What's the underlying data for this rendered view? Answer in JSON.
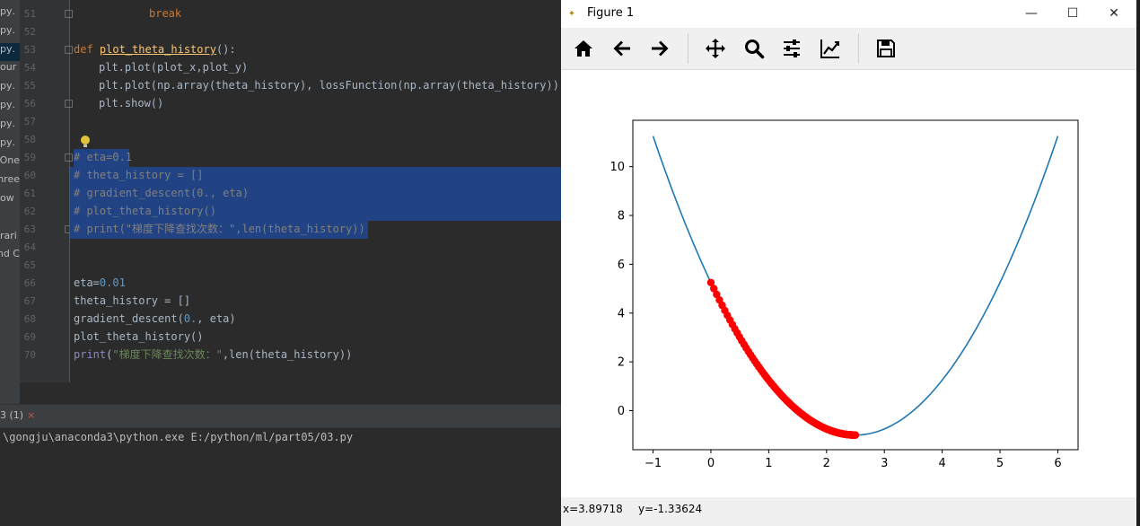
{
  "project_items": [
    {
      "label": ".py",
      "selected": false
    },
    {
      "label": ".py",
      "selected": false
    },
    {
      "label": ".py",
      "selected": true
    },
    {
      "label": "our",
      "selected": false
    },
    {
      "label": ".py",
      "selected": false
    },
    {
      "label": ".py",
      "selected": false
    },
    {
      "label": ".py",
      "selected": false
    },
    {
      "label": ".py",
      "selected": false
    },
    {
      "label": "One",
      "selected": false
    },
    {
      "label": "hree",
      "selected": false
    },
    {
      "label": "ow",
      "selected": false
    },
    {
      "label": "",
      "selected": false
    },
    {
      "label": "rari",
      "selected": false
    },
    {
      "label": "nd C",
      "selected": false
    }
  ],
  "editor": {
    "line_numbers": [
      "51",
      "52",
      "53",
      "54",
      "55",
      "56",
      "57",
      "58",
      "59",
      "60",
      "61",
      "62",
      "63",
      "64",
      "65",
      "66",
      "67",
      "68",
      "69",
      "70"
    ],
    "lines": {
      "l51": "break",
      "l53_def": "def ",
      "l53_name": "plot_theta_history",
      "l53_rest": "():",
      "l54": "plt.plot(plot_x,plot_y)",
      "l55": "plt.plot(np.array(theta_history), lossFunction(np.array(theta_history)), c",
      "l56": "plt.show()",
      "l59": "# eta=0.1",
      "l60": "# theta_history = []",
      "l61": "# gradient_descent(0., eta)",
      "l62": "# plot_theta_history()",
      "l63": "# print(\"梯度下降查找次数：\",len(theta_history))",
      "l66_a": "eta=",
      "l66_b": "0.01",
      "l67": "theta_history = []",
      "l68_a": "gradient_descent(",
      "l68_b": "0.",
      "l68_c": ", eta)",
      "l69": "plot_theta_history()",
      "l70_a": "print",
      "l70_b": "(",
      "l70_c": "\"梯度下降查找次数：\"",
      "l70_d": ",len(theta_history))"
    }
  },
  "run_panel": {
    "tab_label": "3 (1)",
    "close_glyph": "×",
    "console_line": "\\gongju\\anaconda3\\python.exe E:/python/ml/part05/03.py"
  },
  "figure_window": {
    "title": "Figure 1",
    "minimize": "—",
    "maximize": "☐",
    "close": "✕",
    "status_x": "x=3.89718",
    "status_y": "y=-1.33624",
    "colors": {
      "curve": "#1f77b4",
      "points": "#ff0000"
    }
  },
  "toolbar_icons": [
    "home-icon",
    "back-arrow-icon",
    "forward-arrow-icon",
    "pan-icon",
    "zoom-icon",
    "configure-subplots-icon",
    "edit-axis-icon",
    "save-icon"
  ],
  "chart_data": {
    "type": "line",
    "title": "",
    "xlabel": "",
    "ylabel": "",
    "xlim": [
      -1.35,
      6.35
    ],
    "ylim": [
      -1.6,
      11.9
    ],
    "xticks": [
      -1,
      0,
      1,
      2,
      3,
      4,
      5,
      6
    ],
    "yticks": [
      0,
      2,
      4,
      6,
      8,
      10
    ],
    "grid": false,
    "series": [
      {
        "type": "line",
        "function": "(x-2.5)^2 - 1",
        "x_range": [
          -1,
          6
        ],
        "color": "#1f77b4"
      },
      {
        "type": "scatter",
        "color": "#ff0000",
        "x": [
          0.0,
          0.05,
          0.099,
          0.147,
          0.194,
          0.24,
          0.285,
          0.329,
          0.372,
          0.414,
          0.455,
          0.495,
          0.535,
          0.574,
          0.612,
          0.65,
          0.687,
          0.723,
          0.759,
          0.794,
          0.828,
          0.862,
          0.895,
          0.928,
          0.96,
          0.991,
          1.022,
          1.052,
          1.082,
          1.111,
          1.14,
          1.168,
          1.196,
          1.223,
          1.25,
          1.276,
          1.302,
          1.327,
          1.352,
          1.376,
          1.4,
          1.424,
          1.447,
          1.47,
          1.492,
          1.514,
          1.536,
          1.557,
          1.578,
          1.598,
          1.618,
          1.638,
          1.657,
          1.676,
          1.695,
          1.713,
          1.731,
          1.749,
          1.766,
          1.783,
          1.8,
          1.816,
          1.832,
          1.848,
          1.864,
          1.879,
          1.894,
          1.909,
          1.923,
          1.937,
          1.951,
          1.965,
          1.978,
          1.991,
          2.004,
          2.017,
          2.029,
          2.041,
          2.053,
          2.065,
          2.076,
          2.087,
          2.098,
          2.109,
          2.12,
          2.13,
          2.14,
          2.15,
          2.16,
          2.17,
          2.179,
          2.188,
          2.197,
          2.206,
          2.215,
          2.223,
          2.232,
          2.24,
          2.248,
          2.256,
          2.264,
          2.271,
          2.279,
          2.286,
          2.293,
          2.3,
          2.307,
          2.314,
          2.32,
          2.327,
          2.333,
          2.339,
          2.345,
          2.351,
          2.357,
          2.363,
          2.368,
          2.374,
          2.379,
          2.384,
          2.389,
          2.394,
          2.399,
          2.404,
          2.409,
          2.413,
          2.418,
          2.422,
          2.427,
          2.431,
          2.435,
          2.439,
          2.443,
          2.447,
          2.451,
          2.454,
          2.458,
          2.462,
          2.465,
          2.469,
          2.472,
          2.475,
          2.478,
          2.481,
          2.484,
          2.487,
          2.49,
          2.493,
          2.496,
          2.499
        ]
      }
    ]
  }
}
